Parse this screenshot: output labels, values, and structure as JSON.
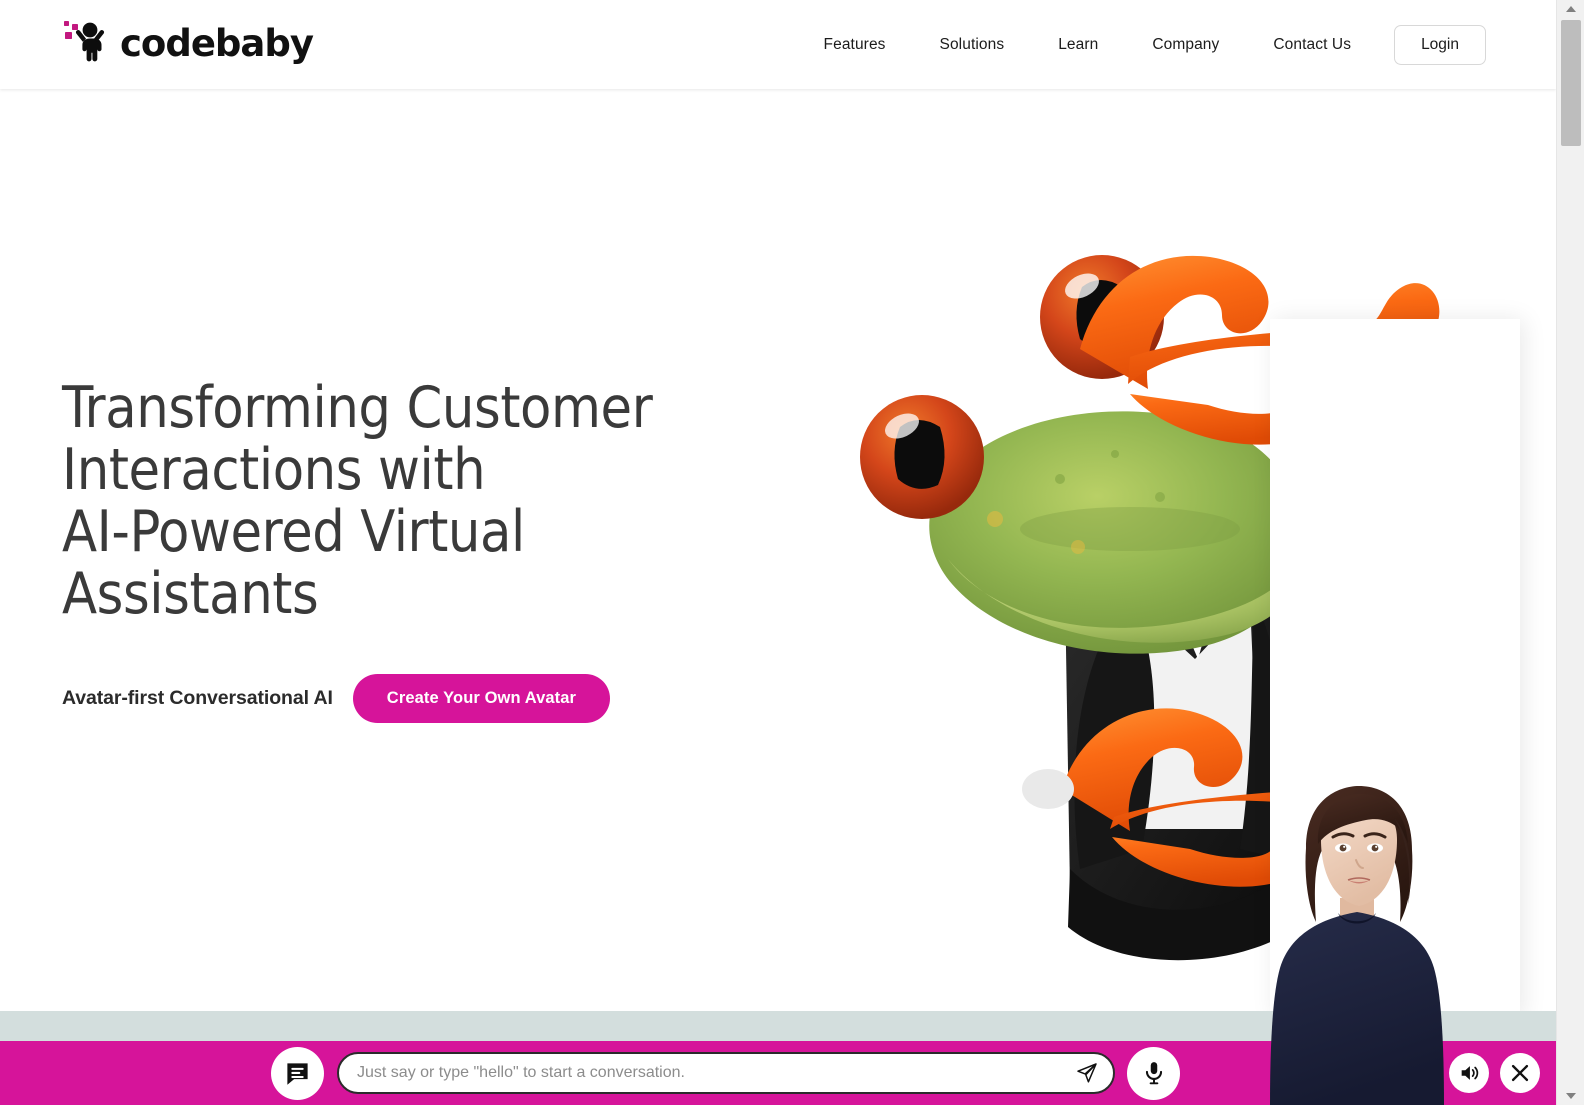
{
  "header": {
    "logo": {
      "name": "codebaby-logo",
      "text": "codebaby",
      "accent_color": "#c2187f"
    },
    "nav": [
      {
        "label": "Features",
        "name": "nav-features"
      },
      {
        "label": "Solutions",
        "name": "nav-solutions"
      },
      {
        "label": "Learn",
        "name": "nav-learn"
      },
      {
        "label": "Company",
        "name": "nav-company"
      },
      {
        "label": "Contact Us",
        "name": "nav-contact-us"
      }
    ],
    "login_label": "Login"
  },
  "hero": {
    "headline": "Transforming Customer\nInteractions with\nAI-Powered Virtual\nAssistants",
    "tagline": "Avatar-first Conversational AI",
    "cta_label": "Create Your Own Avatar",
    "cta_color": "#d6149a",
    "headline_color": "#3a3a3a",
    "illustration": "3d-cartoon-tree-frog-in-black-suit-peeking-around-white-panel"
  },
  "avatar": {
    "description": "3d-female-virtual-assistant-avatar-dark-bob-hair-navy-tshirt"
  },
  "chat": {
    "placeholder": "Just say or type \"hello\" to start a conversation.",
    "value": "",
    "bar_color": "#d6149a",
    "band_color": "#d3dedd",
    "icons": {
      "toggle": "chat-bubble-icon",
      "send": "send-paper-plane-icon",
      "mic": "microphone-icon",
      "extra": "chat-option-icon",
      "volume": "speaker-volume-icon",
      "close": "close-x-icon"
    }
  },
  "scrollbar": {
    "up": "scroll-up-arrow",
    "down": "scroll-down-arrow",
    "thumb": "scroll-thumb"
  }
}
